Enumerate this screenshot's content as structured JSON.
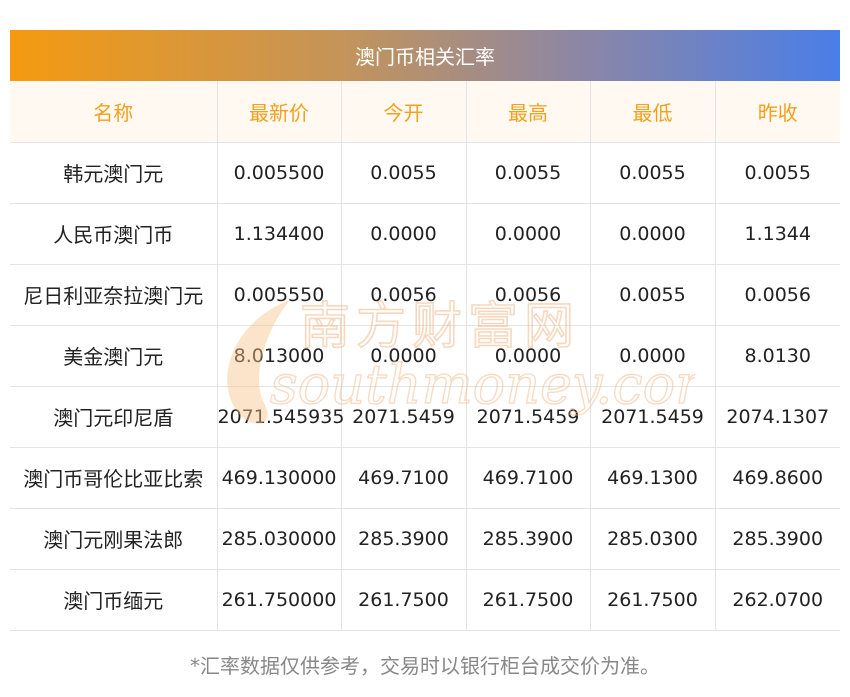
{
  "banner": {
    "title": "澳门币相关汇率"
  },
  "table": {
    "headers": [
      "名称",
      "最新价",
      "今开",
      "最高",
      "最低",
      "昨收"
    ],
    "rows": [
      [
        "韩元澳门元",
        "0.005500",
        "0.0055",
        "0.0055",
        "0.0055",
        "0.0055"
      ],
      [
        "人民币澳门币",
        "1.134400",
        "0.0000",
        "0.0000",
        "0.0000",
        "1.1344"
      ],
      [
        "尼日利亚奈拉澳门元",
        "0.005550",
        "0.0056",
        "0.0056",
        "0.0055",
        "0.0056"
      ],
      [
        "美金澳门元",
        "8.013000",
        "0.0000",
        "0.0000",
        "0.0000",
        "8.0130"
      ],
      [
        "澳门元印尼盾",
        "2071.545935",
        "2071.5459",
        "2071.5459",
        "2071.5459",
        "2074.1307"
      ],
      [
        "澳门币哥伦比亚比索",
        "469.130000",
        "469.7100",
        "469.7100",
        "469.1300",
        "469.8600"
      ],
      [
        "澳门元刚果法郎",
        "285.030000",
        "285.3900",
        "285.3900",
        "285.0300",
        "285.3900"
      ],
      [
        "澳门币缅元",
        "261.750000",
        "261.7500",
        "261.7500",
        "261.7500",
        "262.0700"
      ]
    ]
  },
  "watermark": {
    "cn": "南方财富网",
    "en": "southmoney.com"
  },
  "footnote": "*汇率数据仅供参考，交易时以银行柜台成交价为准。",
  "colors": {
    "header_text": "#f5a01c",
    "header_bg": "#fff9f2",
    "banner_start": "#f59a10",
    "banner_end": "#4a7ee8"
  }
}
